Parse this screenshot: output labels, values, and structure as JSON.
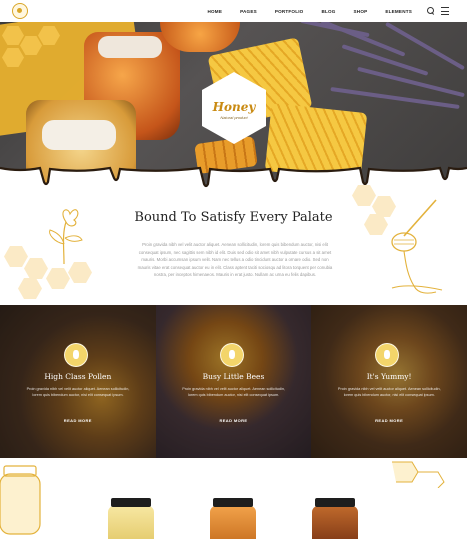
{
  "nav": {
    "items": [
      "HOME",
      "PAGES",
      "PORTFOLIO",
      "BLOG",
      "SHOP",
      "ELEMENTS"
    ],
    "icons": [
      "search-icon",
      "menu-icon"
    ]
  },
  "hero": {
    "label_title": "Honey",
    "label_sub": "Natural product"
  },
  "intro": {
    "title": "Bound To Satisfy Every Palate",
    "text": "Proin gravida nibh vel velit auctor aliquet. Aenean sollicitudin, lorem quis bibendum auctor, nisi elit consequat ipsum, nec sagittis sem nibh id elit. Duis sed odio sit amet nibh vulputate cursus a sit amet mauris. Morbi accumsan ipsum velit. Nam nec tellus a odio tincidunt auctor a ornare odio. Sed non mauris vitae erat consequat auctor eu in elit. Class aptent taciti sociosqu ad litora torquent per conubia nostra, per inceptos himenaeos. Mauris in erat justo. Nullam ac urna eu felis dapibus."
  },
  "cards": [
    {
      "title": "High Class Pollen",
      "text": "Proin gravida nibh vel velit auctor aliquet. Aenean sollicitudin, lorem quis bibendum auctor, nisi elit consequat ipsum.",
      "cta": "READ MORE"
    },
    {
      "title": "Busy Little Bees",
      "text": "Proin gravida nibh vel velit auctor aliquet. Aenean sollicitudin, lorem quis bibendum auctor, nisi elit consequat ipsum.",
      "cta": "READ MORE"
    },
    {
      "title": "It's Yummy!",
      "text": "Proin gravida nibh vel velit auctor aliquet. Aenean sollicitudin, lorem quis bibendum auctor, nisi elit consequat ipsum.",
      "cta": "READ MORE"
    }
  ],
  "colors": {
    "accent": "#e9b12e",
    "dark": "#222222"
  }
}
